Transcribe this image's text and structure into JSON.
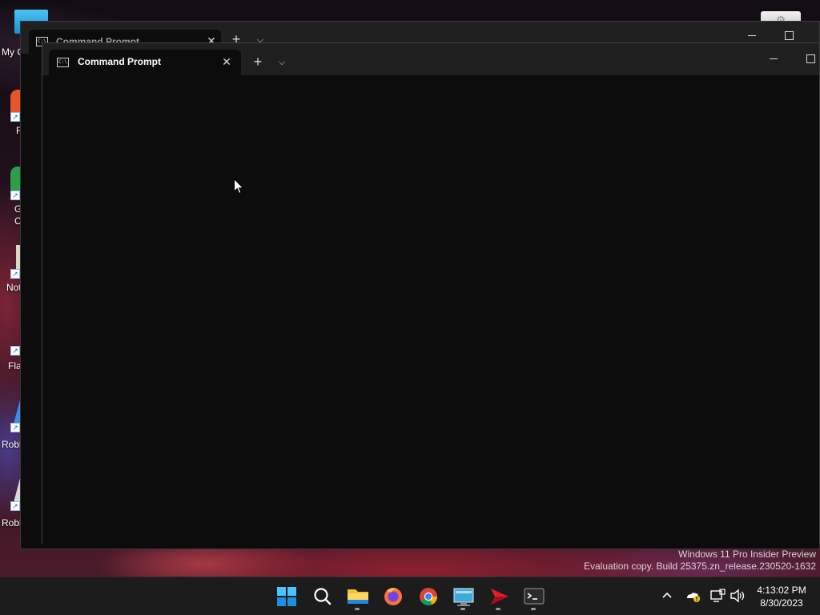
{
  "desktop": {
    "icons": [
      {
        "name": "my-computer",
        "label": "My C"
      },
      {
        "name": "firefox",
        "label": "F"
      },
      {
        "name": "google-chrome",
        "label": "G\nC"
      },
      {
        "name": "notepad",
        "label": "Not"
      },
      {
        "name": "flash",
        "label": "Fla"
      },
      {
        "name": "roblox",
        "label": "Robl"
      },
      {
        "name": "roblox-player",
        "label": "Roblox F"
      }
    ]
  },
  "background_window": {
    "tab_title": "Command Prompt",
    "tab_icon_text": "C:\\"
  },
  "window": {
    "tab_title": "Command Prompt",
    "tab_icon_text": "C:\\",
    "close_tab_glyph": "✕",
    "new_tab_glyph": "+",
    "dropdown_glyph": "⌵",
    "terminal_content": ""
  },
  "watermark": {
    "line1": "Windows 11 Pro Insider Preview",
    "line2": "Evaluation copy. Build 25375.zn_release.230520-1632"
  },
  "taskbar": {
    "apps": [
      {
        "name": "start",
        "icon": "windows-logo-icon",
        "running": false
      },
      {
        "name": "search",
        "icon": "search-icon",
        "running": false
      },
      {
        "name": "file-explorer",
        "icon": "folder-icon",
        "running": true
      },
      {
        "name": "firefox",
        "icon": "firefox-icon",
        "running": false
      },
      {
        "name": "chrome",
        "icon": "chrome-icon",
        "running": false
      },
      {
        "name": "control-panel",
        "icon": "control-panel-icon",
        "running": true
      },
      {
        "name": "app-red-arrow",
        "icon": "red-arrow-icon",
        "running": true
      },
      {
        "name": "terminal",
        "icon": "terminal-icon",
        "running": true
      }
    ],
    "tray": {
      "overflow_glyph": "^",
      "time": "4:13:02 PM",
      "date": "8/30/2023"
    }
  },
  "colors": {
    "terminal_bg": "#0c0c0c",
    "titlebar_bg": "#1f1f1f",
    "taskbar_bg": "#1c1c1c",
    "accent": "#0078d4"
  }
}
